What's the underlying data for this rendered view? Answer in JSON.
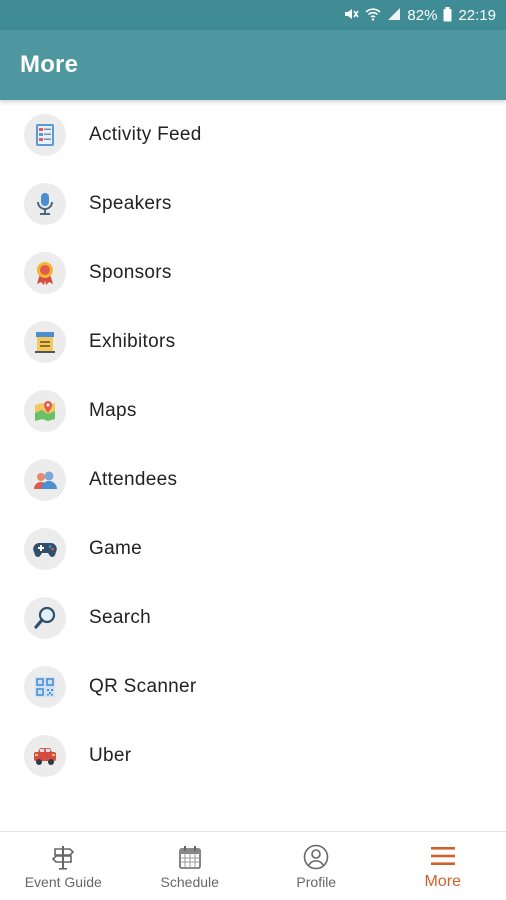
{
  "status_bar": {
    "battery": "82%",
    "time": "22:19",
    "icons": [
      "mute-icon",
      "wifi-icon",
      "signal-icon",
      "battery-icon"
    ]
  },
  "header": {
    "title": "More"
  },
  "menu": {
    "items": [
      {
        "label": "Activity Feed",
        "icon": "activity-feed-icon"
      },
      {
        "label": "Speakers",
        "icon": "microphone-icon"
      },
      {
        "label": "Sponsors",
        "icon": "ribbon-award-icon"
      },
      {
        "label": "Exhibitors",
        "icon": "booth-icon"
      },
      {
        "label": "Maps",
        "icon": "map-pin-icon"
      },
      {
        "label": "Attendees",
        "icon": "people-icon"
      },
      {
        "label": "Game",
        "icon": "gamepad-icon"
      },
      {
        "label": "Search",
        "icon": "magnifier-icon"
      },
      {
        "label": "QR Scanner",
        "icon": "qr-code-icon"
      },
      {
        "label": "Uber",
        "icon": "car-icon"
      }
    ]
  },
  "bottom_nav": {
    "items": [
      {
        "label": "Event Guide",
        "icon": "signpost-icon"
      },
      {
        "label": "Schedule",
        "icon": "calendar-icon"
      },
      {
        "label": "Profile",
        "icon": "profile-icon"
      },
      {
        "label": "More",
        "icon": "hamburger-menu-icon",
        "active": true
      }
    ]
  },
  "colors": {
    "status_bar": "#3f8c94",
    "app_bar": "#4e97a1",
    "active_nav": "#d0602a"
  }
}
